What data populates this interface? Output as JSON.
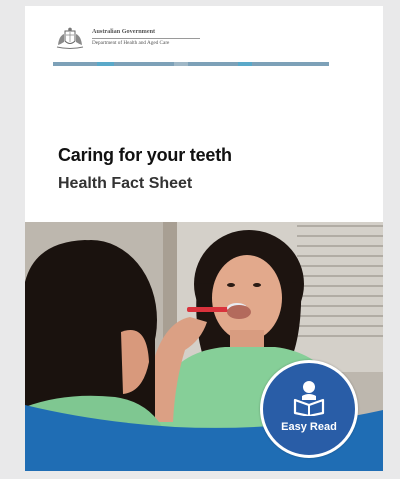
{
  "header": {
    "org_line1": "Australian Government",
    "org_line2": "Department of Health and Aged Care",
    "crest_icon": "coat-of-arms-icon",
    "stripe_colors": [
      "#7da1b8",
      "#5aa9c9",
      "#7da1b8",
      "#9fb7c6",
      "#7da1b8",
      "#5aa9c9",
      "#7da1b8",
      "#7da1b8"
    ]
  },
  "document": {
    "title": "Caring for your teeth",
    "subtitle": "Health Fact Sheet"
  },
  "cover_image": {
    "subject": "woman-brushing-teeth-in-mirror"
  },
  "badge": {
    "label": "Easy Read",
    "icon": "reading-person-icon",
    "color": "#295da7"
  },
  "colors": {
    "wave_blue": "#1f6db4",
    "background": "#e9e9ea"
  }
}
